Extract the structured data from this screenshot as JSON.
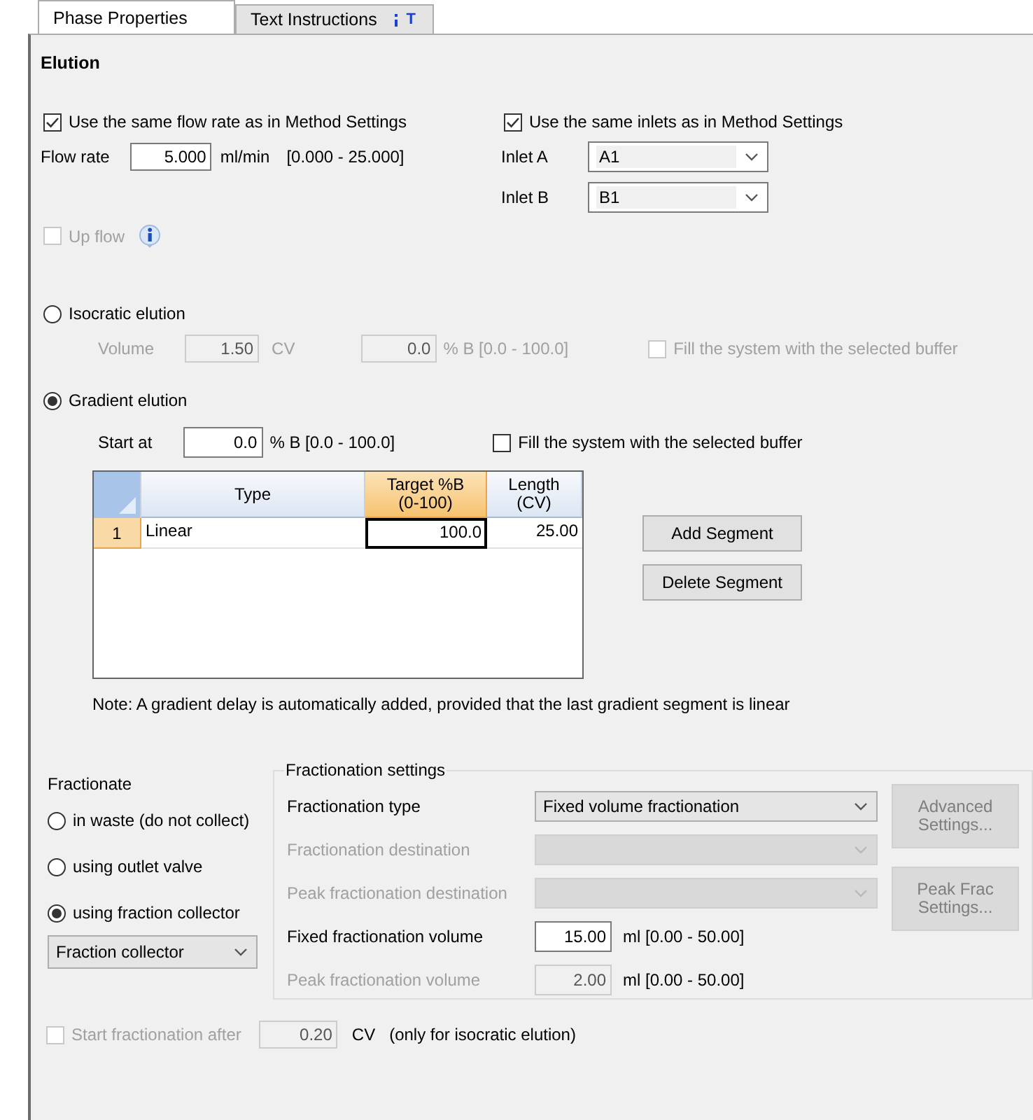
{
  "tabs": [
    {
      "label": "Phase Properties",
      "selected": true
    },
    {
      "label": "Text Instructions",
      "selected": false,
      "tag": "T"
    }
  ],
  "section_title": "Elution",
  "flow": {
    "checkbox": {
      "label": "Use the same flow rate as in Method Settings",
      "checked": true
    },
    "label": "Flow rate",
    "value": "5.000",
    "unit": "ml/min",
    "range": "[0.000 - 25.000]"
  },
  "inlets": {
    "checkbox": {
      "label": "Use the same inlets as in Method Settings",
      "checked": true
    },
    "fields": [
      {
        "label": "Inlet A",
        "value": "A1"
      },
      {
        "label": "Inlet B",
        "value": "B1"
      }
    ]
  },
  "up_flow": {
    "label": "Up flow",
    "checked": false,
    "disabled": true
  },
  "isocratic": {
    "label": "Isocratic elution",
    "selected": false,
    "volume_label": "Volume",
    "volume": "1.50",
    "volume_unit": "CV",
    "percent": "0.0",
    "percent_range": "% B [0.0 - 100.0]",
    "disabled": true,
    "fill": {
      "label": "Fill the system with the selected buffer",
      "checked": false,
      "disabled": true
    }
  },
  "gradient": {
    "label": "Gradient elution",
    "selected": true,
    "start_label": "Start at",
    "start": "0.0",
    "start_range": "% B [0.0 - 100.0]",
    "fill": {
      "label": "Fill the system with the selected buffer",
      "checked": false,
      "disabled": false
    }
  },
  "segments": {
    "columns": [
      {
        "label": "Type",
        "selected": false
      },
      {
        "label": "Target %B (0-100)",
        "selected": true
      },
      {
        "label": "Length (CV)",
        "selected": false
      }
    ],
    "rows": [
      {
        "number": "1",
        "selected": true,
        "cells": [
          "Linear",
          "100.0",
          "25.00"
        ]
      }
    ]
  },
  "segment_buttons": [
    "Add Segment",
    "Delete Segment"
  ],
  "note": "Note: A gradient delay is automatically added, provided that the last gradient segment is linear",
  "fractionate": {
    "title": "Fractionate",
    "options": [
      {
        "label": "in waste (do not collect)",
        "selected": false
      },
      {
        "label": "using outlet valve",
        "selected": false
      },
      {
        "label": "using fraction collector",
        "selected": true
      }
    ],
    "collector": "Fraction collector"
  },
  "fractionation_settings": {
    "title": "Fractionation settings",
    "rows": [
      {
        "kind": "select",
        "label": "Fractionation type",
        "value": "Fixed volume fractionation",
        "disabled": false
      },
      {
        "kind": "select",
        "label": "Fractionation destination",
        "disabled": true
      },
      {
        "kind": "select",
        "label": "Peak fractionation destination",
        "disabled": true
      },
      {
        "kind": "number",
        "label": "Fixed fractionation volume",
        "value": "15.00",
        "range": "ml [0.00 - 50.00]",
        "disabled": false
      },
      {
        "kind": "number",
        "label": "Peak fractionation volume",
        "value": "2.00",
        "range": "ml [0.00 - 50.00]",
        "disabled": true
      }
    ],
    "buttons": [
      {
        "label": "Advanced Settings...",
        "disabled": true
      },
      {
        "label": "Peak Frac Settings...",
        "disabled": true
      }
    ]
  },
  "start_fractionation": {
    "label": "Start fractionation after",
    "checked": false,
    "disabled": true,
    "value": "0.20",
    "unit": "CV",
    "note": "(only for isocratic elution)"
  }
}
